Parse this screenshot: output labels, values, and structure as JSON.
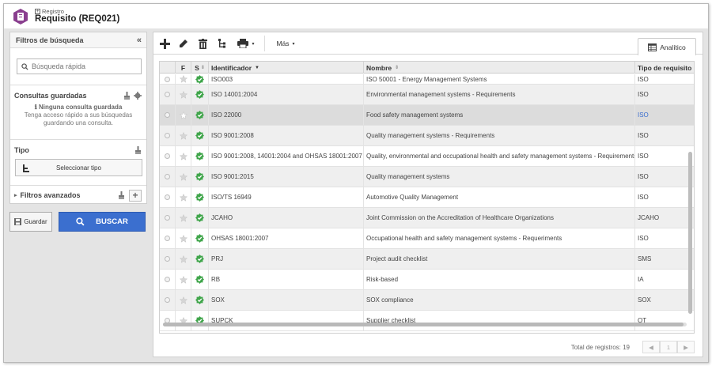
{
  "header": {
    "breadcrumb": "Registro",
    "title": "Requisito (REQ021)"
  },
  "left_panel": {
    "title": "Filtros de búsqueda",
    "search_placeholder": "Búsqueda rápida",
    "saved_title": "Consultas guardadas",
    "empty_title": "Ninguna consulta guardada",
    "empty_text": "Tenga acceso rápido a sus búsquedas guardando una consulta.",
    "tipo_title": "Tipo",
    "select_type_label": "Seleccionar tipo",
    "advanced_label": "Filtros avanzados",
    "save_label": "Guardar",
    "search_button_label": "BUSCAR"
  },
  "toolbar": {
    "more_label": "Más",
    "tab_label": "Analítico"
  },
  "grid": {
    "columns": [
      "F",
      "S",
      "Identificador",
      "Nombre",
      "Tipo de requisito"
    ],
    "rows": [
      {
        "id": "ISO003",
        "name": "ISO 50001 - Energy Management Systems",
        "type": "ISO"
      },
      {
        "id": "ISO 14001:2004",
        "name": "Environmental management systems - Requirements",
        "type": "ISO"
      },
      {
        "id": "ISO 22000",
        "name": "Food safety management systems",
        "type": "ISO"
      },
      {
        "id": "ISO 9001:2008",
        "name": "Quality management systems - Requirements",
        "type": "ISO"
      },
      {
        "id": "ISO 9001:2008, 14001:2004 and OHSAS 18001:2007",
        "name": "Quality, environmental and occupational health and safety management systems - Requirements",
        "type": "ISO"
      },
      {
        "id": "ISO 9001:2015",
        "name": "Quality management systems",
        "type": "ISO"
      },
      {
        "id": "ISO/TS 16949",
        "name": "Automotive Quality Management",
        "type": "ISO"
      },
      {
        "id": "JCAHO",
        "name": "Joint Commission on the Accreditation of Healthcare Organizations",
        "type": "JCAHO"
      },
      {
        "id": "OHSAS 18001:2007",
        "name": "Occupational health and safety management systems - Requeriments",
        "type": "ISO"
      },
      {
        "id": "PRJ",
        "name": "Project audit checklist",
        "type": "SMS"
      },
      {
        "id": "RB",
        "name": "Risk-based",
        "type": "IA"
      },
      {
        "id": "SOX",
        "name": "SOX compliance",
        "type": "SOX"
      },
      {
        "id": "SUPCK",
        "name": "Supplier checklist",
        "type": "OT"
      }
    ],
    "total_label": "Total de registros: 19",
    "page": "1"
  },
  "colors": {
    "accent": "#3b6fcf",
    "logo": "#8a3f8f",
    "status_green": "#3fa54a"
  }
}
